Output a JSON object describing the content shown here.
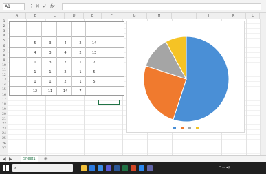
{
  "app": {
    "name_box": "A1",
    "formula_value": ""
  },
  "columns": [
    "A",
    "B",
    "C",
    "D",
    "E",
    "F",
    "G",
    "H",
    "I",
    "J",
    "K",
    "L"
  ],
  "rows": [
    "1",
    "2",
    "3",
    "4",
    "5",
    "6",
    "7",
    "8",
    "9",
    "10",
    "11",
    "12",
    "13",
    "14",
    "15",
    "16",
    "17",
    "18",
    "19",
    "20",
    "21",
    "22",
    "23",
    "24",
    "25",
    "26",
    "27"
  ],
  "table": {
    "title": "",
    "headers": [
      "",
      "",
      "",
      "",
      "",
      ""
    ],
    "rows": [
      {
        "label": "",
        "values": [
          "5",
          "3",
          "4",
          "2",
          "14",
          ""
        ]
      },
      {
        "label": "",
        "values": [
          "4",
          "3",
          "4",
          "2",
          "13",
          ""
        ]
      },
      {
        "label": "",
        "values": [
          "1",
          "3",
          "2",
          "1",
          "7",
          ""
        ]
      },
      {
        "label": "",
        "values": [
          "1",
          "1",
          "2",
          "1",
          "5",
          ""
        ]
      },
      {
        "label": "",
        "values": [
          "1",
          "1",
          "2",
          "1",
          "5",
          ""
        ]
      }
    ],
    "total": {
      "label": "",
      "values": [
        "12",
        "11",
        "14",
        "7",
        "",
        ""
      ]
    }
  },
  "chart_data": {
    "type": "pie",
    "title": "",
    "labels": [
      "",
      "",
      "",
      ""
    ],
    "values": [
      55,
      25,
      12,
      8
    ],
    "colors": [
      "#4a8fd6",
      "#f07a2e",
      "#a5a5a5",
      "#f5c325"
    ],
    "value_labels": [
      "",
      "",
      "",
      ""
    ]
  },
  "legend": [
    "",
    "",
    "",
    ""
  ],
  "sheet_tab": "Sheet1",
  "taskbar": {
    "search_placeholder": "",
    "icons": [
      "file-explorer-icon",
      "edge-icon",
      "mail-icon",
      "store-icon",
      "word-icon",
      "excel-icon",
      "powerpoint-icon",
      "photos-icon",
      "teams-icon"
    ],
    "time": "",
    "date": ""
  }
}
